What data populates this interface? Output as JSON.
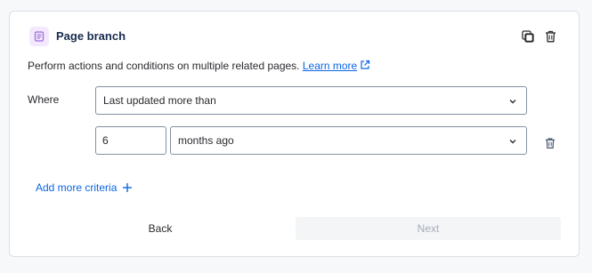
{
  "card": {
    "title": "Page branch",
    "header_icon": "page-icon",
    "actions": [
      "duplicate-icon",
      "trash-icon"
    ]
  },
  "description": {
    "text": "Perform actions and conditions on multiple related pages.",
    "link": "Learn more",
    "link_icon": "external-link-icon"
  },
  "condition": {
    "label": "Where",
    "field_value": "Last updated more than",
    "number_value": "6",
    "unit_value": "months ago"
  },
  "add_criteria_label": "Add more criteria",
  "footer": {
    "back_label": "Back",
    "next_label": "Next"
  },
  "colors": {
    "accent": "#0c66e4",
    "icon_bg": "#f3e8fd",
    "icon_fg": "#8f6bd0",
    "disabled_bg": "#f4f5f7",
    "disabled_text": "#a5adba"
  }
}
